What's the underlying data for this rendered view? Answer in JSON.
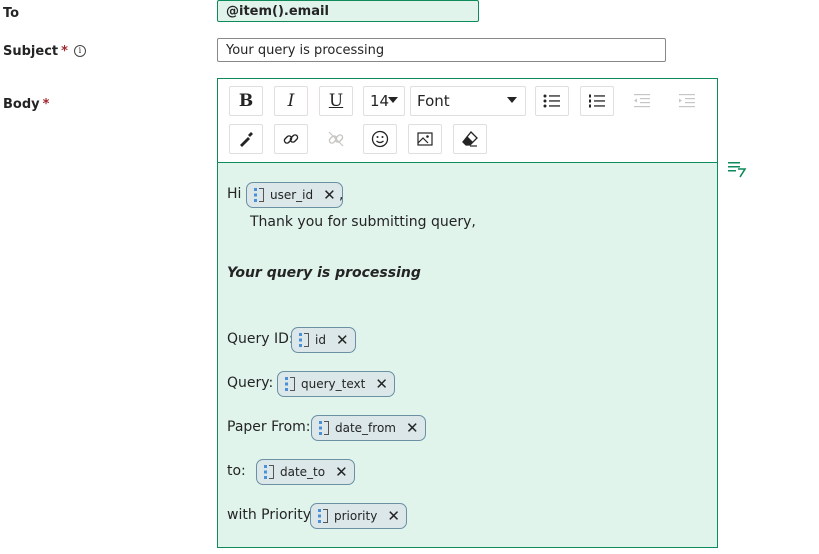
{
  "form": {
    "to_label": "To",
    "to_value": "@item().email",
    "subject_label": "Subject",
    "subject_required": "*",
    "subject_info_icon": "info-icon",
    "subject_value": "Your query is processing",
    "body_label": "Body",
    "body_required": "*"
  },
  "toolbar": {
    "bold": "B",
    "italic": "I",
    "underline": "U",
    "font_size": "14",
    "font": "Font",
    "icons": [
      "bullet-list-icon",
      "numbered-list-icon",
      "indent-decrease-icon",
      "indent-increase-icon",
      "color-picker-icon",
      "link-icon",
      "unlink-icon",
      "emoji-icon",
      "image-icon",
      "clear-format-icon"
    ]
  },
  "body": {
    "greeting": "Hi",
    "comma": ",",
    "thanks": "Thank you for submitting query,",
    "heading": "Your query is processing",
    "query_id_label": "Query ID:",
    "query_label": "Query:",
    "paper_from_label": "Paper From:",
    "to_label": "to:",
    "priority_label": "with Priority:",
    "chips": {
      "user_id": "user_id",
      "id": "id",
      "query_text": "query_text",
      "date_from": "date_from",
      "date_to": "date_to",
      "priority": "priority"
    }
  },
  "colors": {
    "accent": "#0e8a5b",
    "editor_bg": "#e0f4ec",
    "chip_bg": "#dbe7e8",
    "chip_border": "#6b8fa3",
    "required": "#a4262c"
  }
}
